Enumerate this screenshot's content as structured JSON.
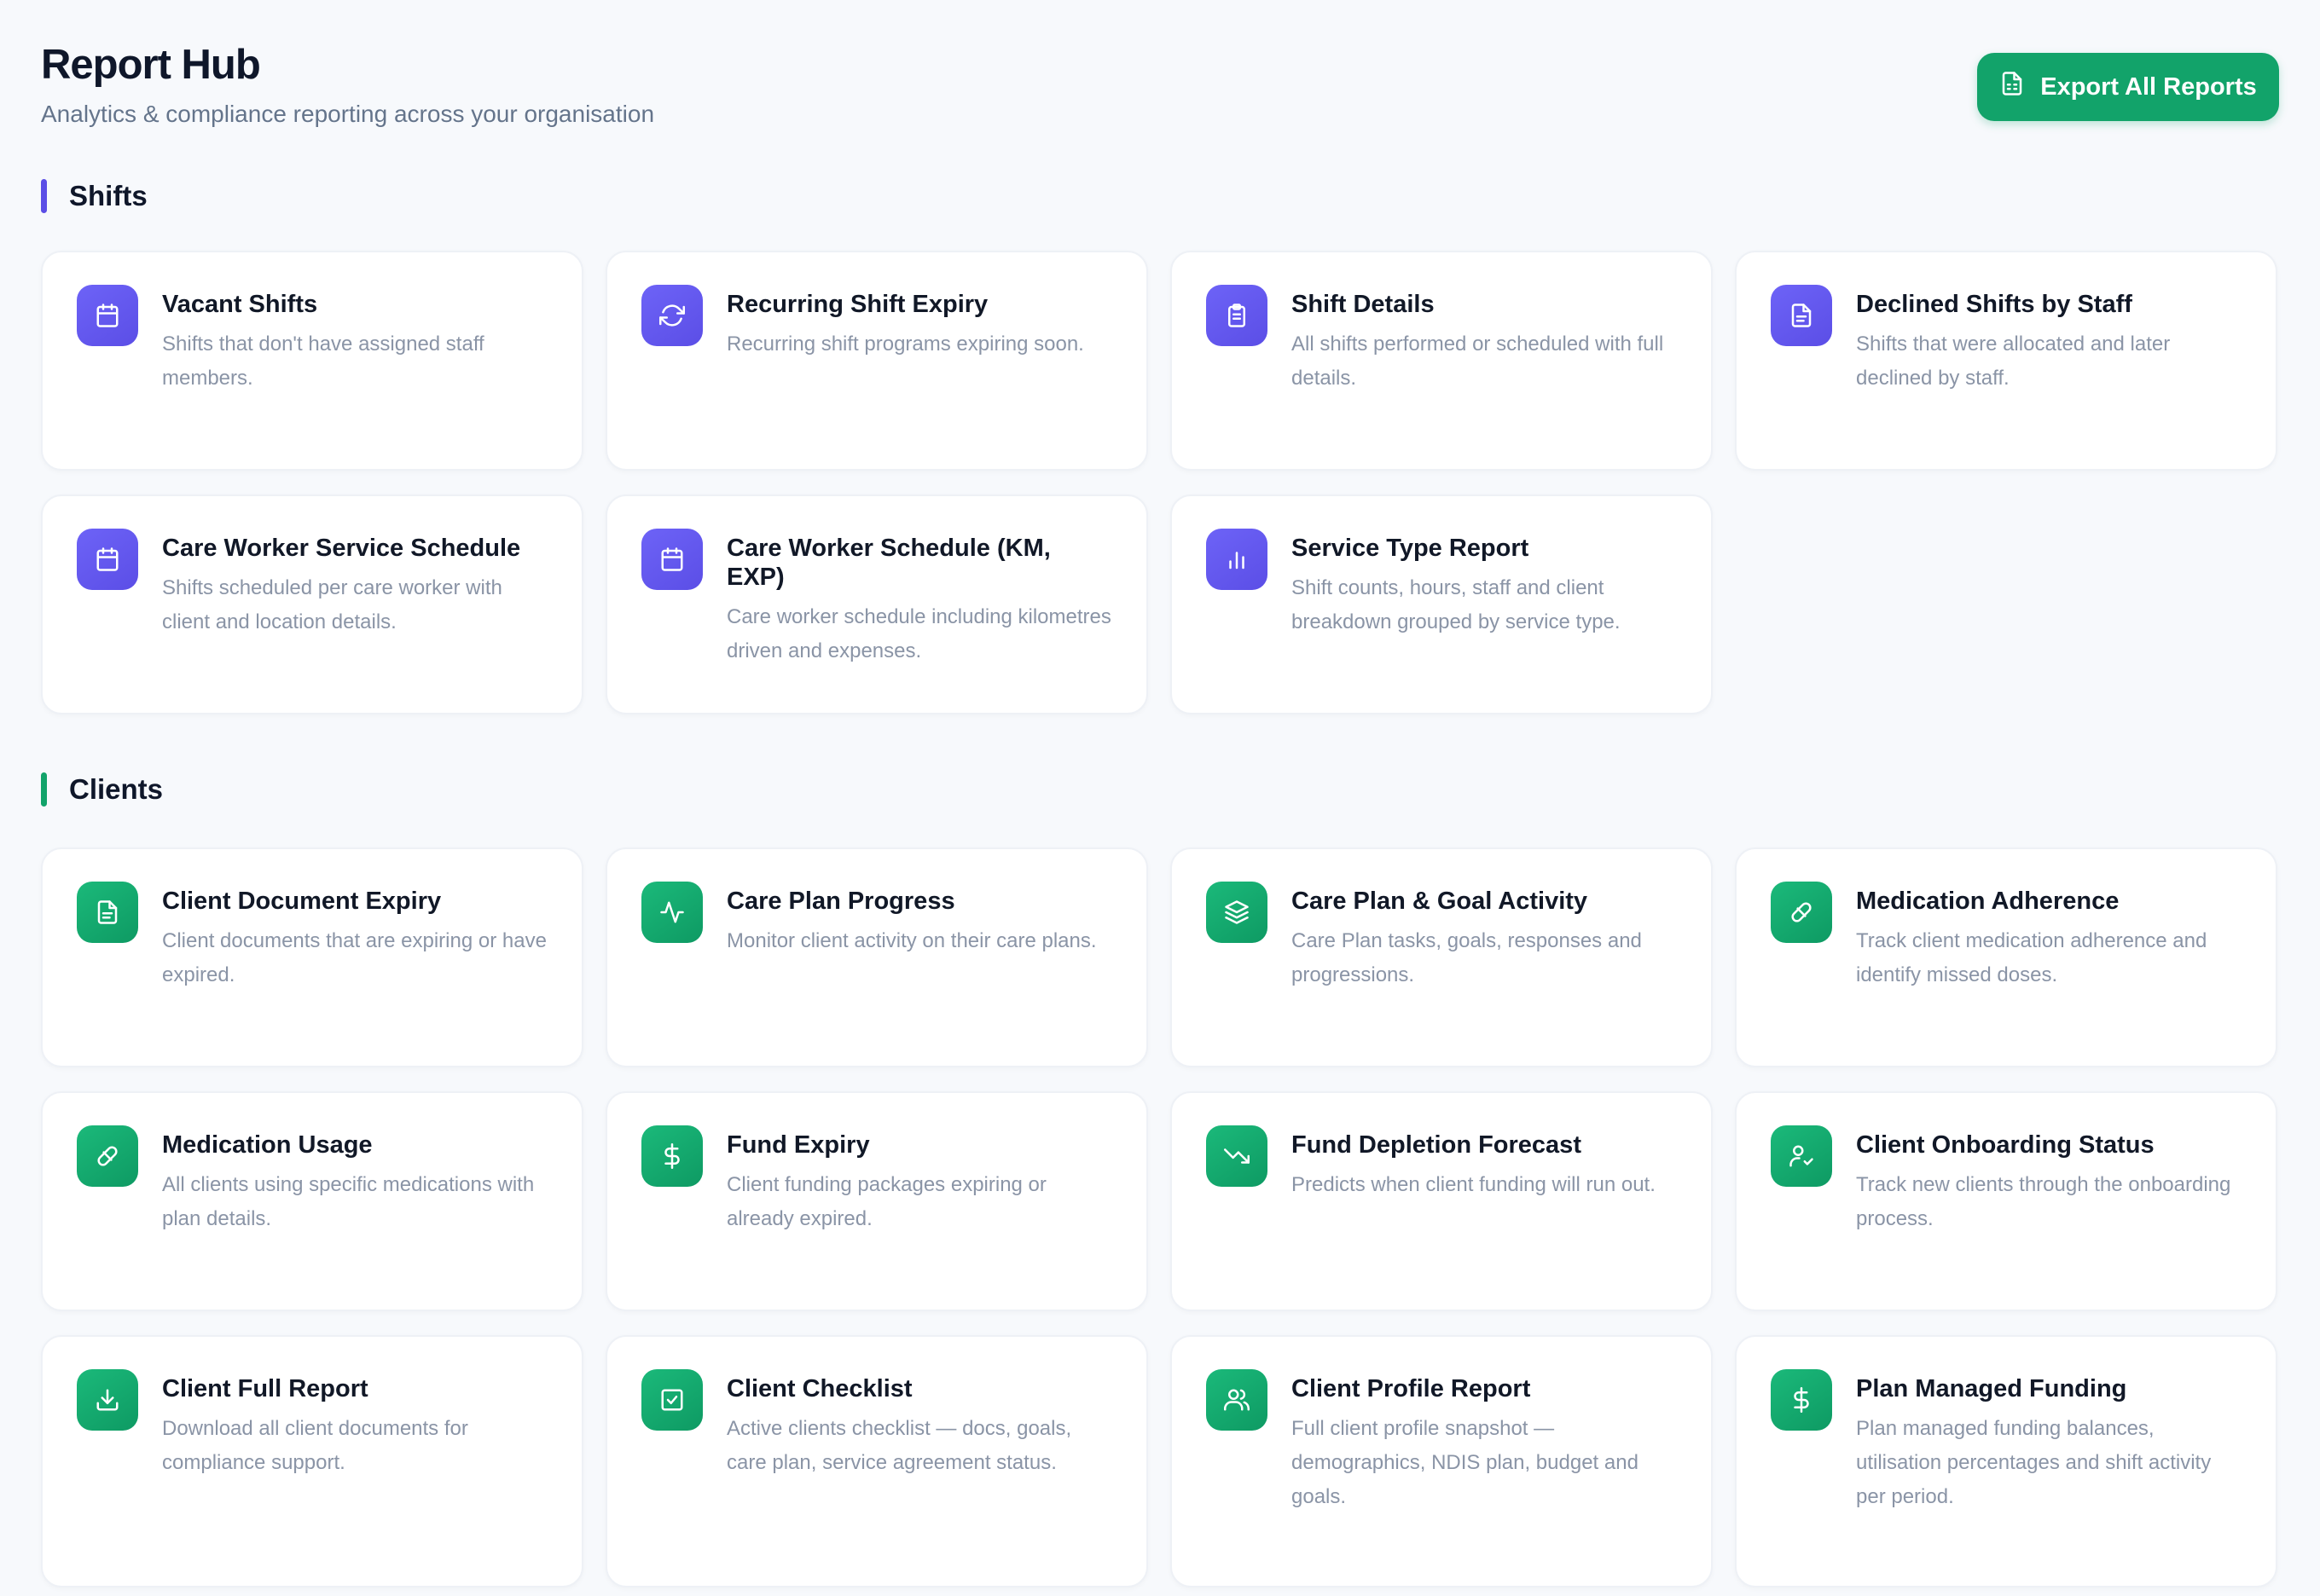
{
  "header": {
    "title": "Report Hub",
    "subtitle": "Analytics & compliance reporting across your organisation",
    "export_label": "Export All Reports"
  },
  "colors": {
    "shifts_accent": "#5b4ee6",
    "clients_accent": "#12a36a"
  },
  "sections": {
    "shifts": {
      "title": "Shifts",
      "cards": [
        {
          "title": "Vacant Shifts",
          "desc": "Shifts that don't have assigned staff members.",
          "icon": "calendar-icon"
        },
        {
          "title": "Recurring Shift Expiry",
          "desc": "Recurring shift programs expiring soon.",
          "icon": "refresh-icon"
        },
        {
          "title": "Shift Details",
          "desc": "All shifts performed or scheduled with full details.",
          "icon": "clipboard-icon"
        },
        {
          "title": "Declined Shifts by Staff",
          "desc": "Shifts that were allocated and later declined by staff.",
          "icon": "document-icon"
        },
        {
          "title": "Care Worker Service Schedule",
          "desc": "Shifts scheduled per care worker with client and location details.",
          "icon": "calendar-icon"
        },
        {
          "title": "Care Worker Schedule (KM, EXP)",
          "desc": "Care worker schedule including kilometres driven and expenses.",
          "icon": "calendar-icon"
        },
        {
          "title": "Service Type Report",
          "desc": "Shift counts, hours, staff and client breakdown grouped by service type.",
          "icon": "bar-chart-icon"
        }
      ]
    },
    "clients": {
      "title": "Clients",
      "cards": [
        {
          "title": "Client Document Expiry",
          "desc": "Client documents that are expiring or have expired.",
          "icon": "document-icon"
        },
        {
          "title": "Care Plan Progress",
          "desc": "Monitor client activity on their care plans.",
          "icon": "activity-icon"
        },
        {
          "title": "Care Plan & Goal Activity",
          "desc": "Care Plan tasks, goals, responses and progressions.",
          "icon": "layers-icon"
        },
        {
          "title": "Medication Adherence",
          "desc": "Track client medication adherence and identify missed doses.",
          "icon": "pill-icon"
        },
        {
          "title": "Medication Usage",
          "desc": "All clients using specific medications with plan details.",
          "icon": "pill-icon"
        },
        {
          "title": "Fund Expiry",
          "desc": "Client funding packages expiring or already expired.",
          "icon": "dollar-icon"
        },
        {
          "title": "Fund Depletion Forecast",
          "desc": "Predicts when client funding will run out.",
          "icon": "trending-down-icon"
        },
        {
          "title": "Client Onboarding Status",
          "desc": "Track new clients through the onboarding process.",
          "icon": "user-check-icon"
        },
        {
          "title": "Client Full Report",
          "desc": "Download all client documents for compliance support.",
          "icon": "download-icon"
        },
        {
          "title": "Client Checklist",
          "desc": "Active clients checklist — docs, goals, care plan, service agreement status.",
          "icon": "checkbox-icon"
        },
        {
          "title": "Client Profile Report",
          "desc": "Full client profile snapshot — demographics, NDIS plan, budget and goals.",
          "icon": "users-icon"
        },
        {
          "title": "Plan Managed Funding",
          "desc": "Plan managed funding balances, utilisation percentages and shift activity per period.",
          "icon": "dollar-icon"
        }
      ]
    }
  }
}
